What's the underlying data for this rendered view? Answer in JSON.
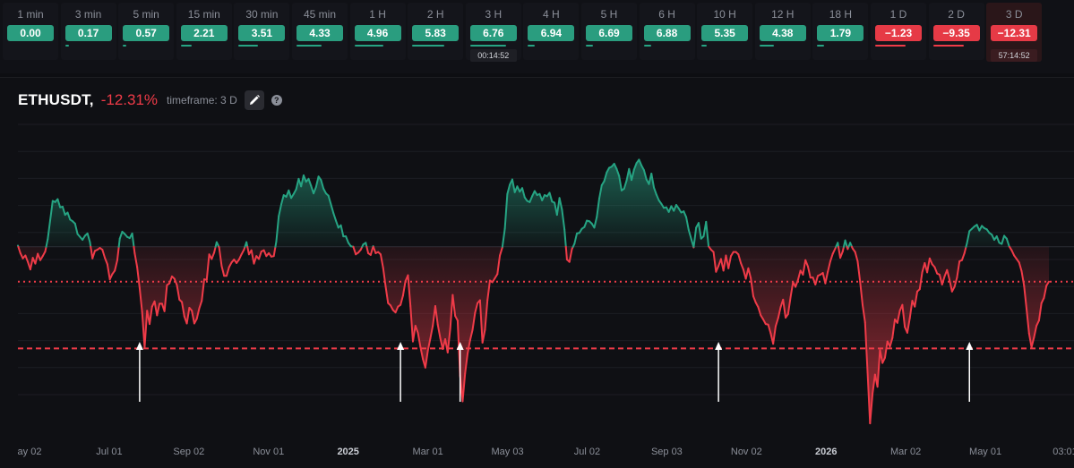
{
  "timeframes": [
    {
      "label": "1 min",
      "value": "0.00",
      "color": "green",
      "bar": 0.0
    },
    {
      "label": "3 min",
      "value": "0.17",
      "color": "green",
      "bar": 0.05
    },
    {
      "label": "5 min",
      "value": "0.57",
      "color": "green",
      "bar": 0.1
    },
    {
      "label": "15 min",
      "value": "2.21",
      "color": "green",
      "bar": 0.3
    },
    {
      "label": "30 min",
      "value": "3.51",
      "color": "green",
      "bar": 0.55
    },
    {
      "label": "45 min",
      "value": "4.33",
      "color": "green",
      "bar": 0.7
    },
    {
      "label": "1 H",
      "value": "4.96",
      "color": "green",
      "bar": 0.8
    },
    {
      "label": "2 H",
      "value": "5.83",
      "color": "green",
      "bar": 0.9
    },
    {
      "label": "3 H",
      "value": "6.76",
      "color": "green",
      "bar": 1.0,
      "timer": "00:14:52"
    },
    {
      "label": "4 H",
      "value": "6.94",
      "color": "green",
      "bar": 0.2
    },
    {
      "label": "5 H",
      "value": "6.69",
      "color": "green",
      "bar": 0.2
    },
    {
      "label": "6 H",
      "value": "6.88",
      "color": "green",
      "bar": 0.2
    },
    {
      "label": "10 H",
      "value": "5.35",
      "color": "green",
      "bar": 0.15
    },
    {
      "label": "12 H",
      "value": "4.38",
      "color": "green",
      "bar": 0.4
    },
    {
      "label": "18 H",
      "value": "1.79",
      "color": "green",
      "bar": 0.2
    },
    {
      "label": "1 D",
      "value": "−1.23",
      "color": "red",
      "bar": 0.85
    },
    {
      "label": "2 D",
      "value": "−9.35",
      "color": "red",
      "bar": 0.85
    },
    {
      "label": "3 D",
      "value": "−12.31",
      "color": "red",
      "bar": 0.0,
      "timer": "57:14:52",
      "active": true
    }
  ],
  "colors": {
    "green": "#26a483",
    "red": "#ef3b48",
    "badge_green": "#2a9d7f",
    "badge_red": "#e63a46"
  },
  "header": {
    "symbol": "ETHUSDT,",
    "change": "-12.31%",
    "timeframe": "timeframe: 3 D",
    "edit_icon": "pencil-icon",
    "help_icon": "question-icon",
    "help_glyph": "?"
  },
  "chart_data": {
    "type": "area",
    "baseline": 0,
    "thresholds": [
      {
        "value": -6,
        "style": "dotted"
      },
      {
        "value": -17.5,
        "style": "dashed"
      }
    ],
    "ylim": [
      -33,
      22
    ],
    "x_ticks": [
      {
        "label": "ay 02",
        "bold": false
      },
      {
        "label": "Jul 01",
        "bold": false
      },
      {
        "label": "Sep 02",
        "bold": false
      },
      {
        "label": "Nov 01",
        "bold": false
      },
      {
        "label": "2025",
        "bold": true
      },
      {
        "label": "Mar 01",
        "bold": false
      },
      {
        "label": "May 03",
        "bold": false
      },
      {
        "label": "Jul 02",
        "bold": false
      },
      {
        "label": "Sep 03",
        "bold": false
      },
      {
        "label": "Nov 02",
        "bold": false
      },
      {
        "label": "2026",
        "bold": true
      },
      {
        "label": "Mar 02",
        "bold": false
      },
      {
        "label": "May 01",
        "bold": false
      },
      {
        "label": "03:01",
        "bold": false
      }
    ],
    "arrow_indices": [
      49,
      154,
      178,
      282,
      383
    ],
    "values": [
      0.2,
      -1.1,
      -2.0,
      -1.5,
      -2.6,
      -3.9,
      -1.9,
      -2.9,
      -1.2,
      -2.3,
      -1.6,
      -0.8,
      1.3,
      4.6,
      7.9,
      7.7,
      8.2,
      6.8,
      6.9,
      5.5,
      5.9,
      4.7,
      4.4,
      4.0,
      2.2,
      1.7,
      1.2,
      1.9,
      2.3,
      0.8,
      -2.0,
      -0.7,
      -0.5,
      -0.2,
      -0.5,
      -1.9,
      -3.0,
      -5.6,
      -4.7,
      -4.1,
      -2.3,
      1.4,
      2.6,
      2.2,
      1.7,
      1.5,
      2.3,
      -1.1,
      -3.5,
      -7.1,
      -11.2,
      -17.3,
      -11.0,
      -13.3,
      -10.3,
      -9.4,
      -11.8,
      -9.8,
      -9.8,
      -11.1,
      -6.6,
      -6.3,
      -5.1,
      -5.5,
      -6.6,
      -9.1,
      -9.5,
      -12.0,
      -13.2,
      -10.5,
      -11.0,
      -13.2,
      -12.4,
      -10.6,
      -9.3,
      -5.6,
      -5.7,
      -1.3,
      -2.1,
      -1.0,
      0.8,
      -0.1,
      -3.3,
      -5.0,
      -5.0,
      -3.5,
      -2.7,
      -2.2,
      -2.8,
      -2.2,
      -1.3,
      -0.5,
      0.8,
      -1.3,
      -0.6,
      -2.9,
      -1.6,
      -2.1,
      -0.8,
      -0.6,
      -1.6,
      -1.1,
      -1.7,
      -1.6,
      0.9,
      5.3,
      7.3,
      8.9,
      8.6,
      9.7,
      8.4,
      9.1,
      9.9,
      11.7,
      10.4,
      12.3,
      11.2,
      11.7,
      10.5,
      9.2,
      10.3,
      12.1,
      11.5,
      10.0,
      9.2,
      8.8,
      7.3,
      5.8,
      4.5,
      3.3,
      3.7,
      1.8,
      1.8,
      0.7,
      0.1,
      0.0,
      -1.3,
      -1.0,
      -0.5,
      0.4,
      0.7,
      -1.1,
      -1.4,
      0.1,
      -1.1,
      -0.9,
      -1.3,
      -3.6,
      -6.8,
      -9.7,
      -10.1,
      -10.9,
      -11.3,
      -10.3,
      -10.0,
      -8.4,
      -5.9,
      -4.9,
      -10.2,
      -16.3,
      -13.6,
      -14.8,
      -17.2,
      -19.3,
      -20.8,
      -17.9,
      -15.8,
      -13.6,
      -10.2,
      -13.4,
      -15.7,
      -17.6,
      -15.9,
      -18.2,
      -14.2,
      -8.3,
      -11.9,
      -12.7,
      -22.2,
      -26.6,
      -21.8,
      -18.4,
      -16.1,
      -14.3,
      -11.4,
      -9.7,
      -9.2,
      -16.5,
      -14.3,
      -9.2,
      -5.8,
      -6.1,
      -5.4,
      -4.7,
      -1.5,
      -0.1,
      3.1,
      9.1,
      10.7,
      11.6,
      9.4,
      10.4,
      9.5,
      10.1,
      8.5,
      7.9,
      7.7,
      8.7,
      9.6,
      8.9,
      9.1,
      8.0,
      8.9,
      8.7,
      9.3,
      7.8,
      7.6,
      5.5,
      8.4,
      6.4,
      3.0,
      -2.2,
      -2.6,
      -0.4,
      0.5,
      2.3,
      2.4,
      3.1,
      3.4,
      4.5,
      4.4,
      4.0,
      3.3,
      5.1,
      8.3,
      10.6,
      11.3,
      12.8,
      13.6,
      13.8,
      14.3,
      13.4,
      12.2,
      9.7,
      10.0,
      11.4,
      13.4,
      11.5,
      13.3,
      14.4,
      15.0,
      14.0,
      13.2,
      11.6,
      10.8,
      12.6,
      10.2,
      9.0,
      8.0,
      7.4,
      6.7,
      6.8,
      6.0,
      7.0,
      6.2,
      7.2,
      6.6,
      5.9,
      6.1,
      5.1,
      2.9,
      1.4,
      -0.1,
      3.3,
      4.1,
      1.4,
      1.8,
      4.3,
      0.1,
      -0.5,
      -0.9,
      -4.3,
      -3.3,
      -2.1,
      -4.1,
      -1.5,
      -3.7,
      -1.6,
      -0.9,
      -0.9,
      -1.3,
      -2.8,
      -3.9,
      -5.5,
      -3.7,
      -5.4,
      -8.5,
      -9.6,
      -10.4,
      -11.8,
      -12.5,
      -13.3,
      -13.4,
      -14.9,
      -16.7,
      -13.7,
      -12.3,
      -10.4,
      -9.1,
      -12.2,
      -11.6,
      -8.7,
      -6.1,
      -6.9,
      -5.7,
      -4.1,
      -4.8,
      -2.3,
      -3.4,
      -5.3,
      -5.3,
      -6.5,
      -5.0,
      -4.8,
      -4.5,
      -6.3,
      -4.3,
      -2.5,
      -1.2,
      -0.3,
      0.7,
      -1.9,
      -0.8,
      1.1,
      -0.4,
      0.7,
      -0.3,
      -0.9,
      -2.5,
      -6.0,
      -10.0,
      -13.0,
      -21.6,
      -30.4,
      -25.3,
      -22.0,
      -24.1,
      -17.8,
      -20.0,
      -19.1,
      -16.3,
      -17.2,
      -15.7,
      -12.5,
      -13.1,
      -11.0,
      -10.0,
      -13.8,
      -14.8,
      -12.3,
      -9.3,
      -10.3,
      -7.7,
      -7.3,
      -4.4,
      -2.8,
      -4.4,
      -2.0,
      -3.0,
      -3.5,
      -4.6,
      -4.8,
      -6.5,
      -5.1,
      -4.0,
      -5.7,
      -7.7,
      -6.9,
      -5.3,
      -2.5,
      -2.3,
      -1.1,
      0.6,
      2.7,
      3.1,
      3.5,
      3.8,
      2.8,
      3.6,
      3.2,
      3.0,
      2.4,
      2.1,
      1.2,
      1.8,
      0.7,
      0.5,
      1.9,
      1.4,
      0.1,
      -0.6,
      -1.5,
      -2.1,
      -2.7,
      -4.2,
      -6.7,
      -10.7,
      -14.9,
      -17.3,
      -15.6,
      -13.6,
      -12.7,
      -9.7,
      -8.8,
      -6.7,
      -6.0
    ]
  }
}
